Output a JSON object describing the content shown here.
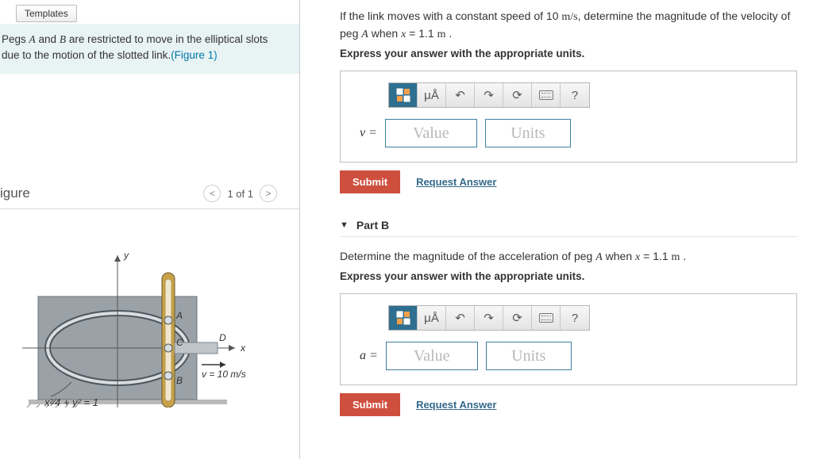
{
  "left": {
    "templates_label": "Templates",
    "intro_html": "Pegs A and B are restricted to move in the elliptical slots due to the motion of the slotted link.",
    "figure_link": "(Figure 1)",
    "figure_title": "igure",
    "pager_text": "1 of 1",
    "diagram": {
      "eq": "x²⁄4 + y² = 1",
      "y_label": "y",
      "x_label": "x",
      "A": "A",
      "B": "B",
      "C": "C",
      "D": "D",
      "v_label": "v = 10 m/s"
    }
  },
  "partA": {
    "prompt": "If the link moves with a constant speed of 10 m/s, determine the magnitude of the velocity of peg A when x = 1.1 m .",
    "express": "Express your answer with the appropriate units.",
    "var": "v =",
    "value_ph": "Value",
    "units_ph": "Units",
    "toolbar": {
      "mu": "μÅ",
      "help": "?"
    },
    "submit": "Submit",
    "request": "Request Answer"
  },
  "partB": {
    "header": "Part B",
    "prompt": "Determine the magnitude of the acceleration of peg A when x = 1.1 m .",
    "express": "Express your answer with the appropriate units.",
    "var": "a =",
    "value_ph": "Value",
    "units_ph": "Units",
    "toolbar": {
      "mu": "μÅ",
      "help": "?"
    },
    "submit": "Submit",
    "request": "Request Answer"
  }
}
